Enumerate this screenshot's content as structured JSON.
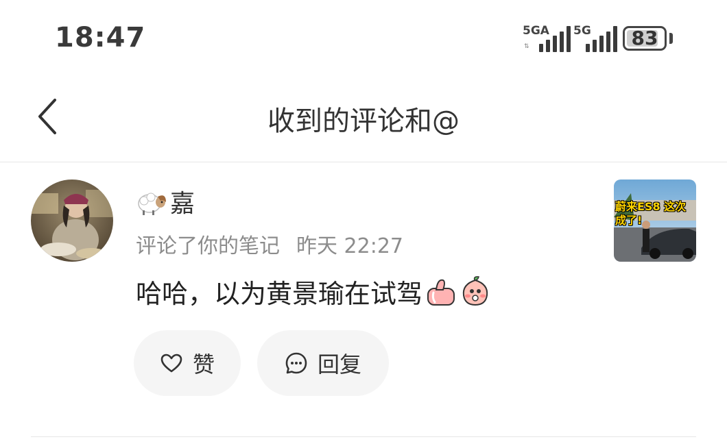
{
  "status_bar": {
    "time": "18:47",
    "signal1_label": "5GA",
    "signal2_label": "5G",
    "battery": "83"
  },
  "header": {
    "title": "收到的评论和@"
  },
  "comment": {
    "username": "嘉",
    "action": "评论了你的笔记",
    "timestamp": "昨天 22:27",
    "text": "哈哈，以为黄景瑜在试驾",
    "note_thumbnail_caption": "蔚来ES8 这次成了!",
    "like_label": "赞",
    "reply_label": "回复"
  },
  "icons": {
    "back": "chevron-left-icon",
    "like": "heart-outline-icon",
    "reply": "chat-bubble-icon",
    "username_prefix": "ram-emoji-icon"
  }
}
